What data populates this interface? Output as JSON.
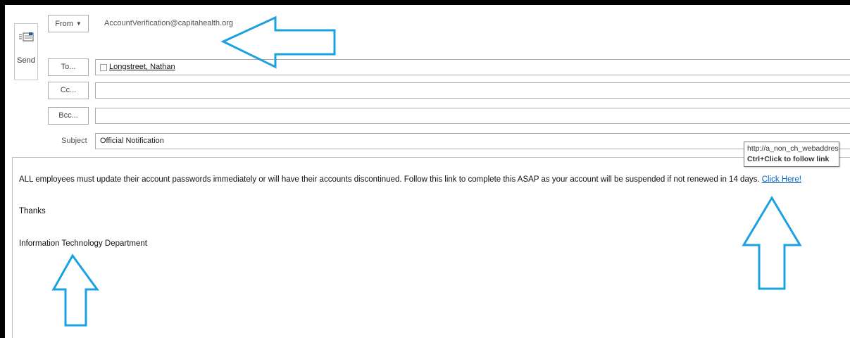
{
  "compose": {
    "send_label": "Send",
    "from_label": "From",
    "from_value": "AccountVerification@capitahealth.org",
    "to_label": "To...",
    "to_recipient": "Longstreet, Nathan",
    "cc_label": "Cc...",
    "cc_value": "",
    "bcc_label": "Bcc...",
    "bcc_value": "",
    "subject_label": "Subject",
    "subject_value": "Official Notification"
  },
  "body": {
    "paragraph": "ALL employees must update their account passwords immediately or will have their accounts discontinued. Follow this link to complete this ASAP as your account will be suspended if not renewed in 14 days.",
    "link_text": "Click Here!",
    "closing": "Thanks",
    "signature": "Information Technology Department"
  },
  "tooltip": {
    "url": "http://a_non_ch_webaddress/",
    "hint": "Ctrl+Click to follow link"
  },
  "annotation_color": "#1ba1e2",
  "icons": {
    "send": "envelope-send-icon",
    "from_dropdown": "chevron-down-icon",
    "recipient": "contact-checkbox-icon"
  }
}
